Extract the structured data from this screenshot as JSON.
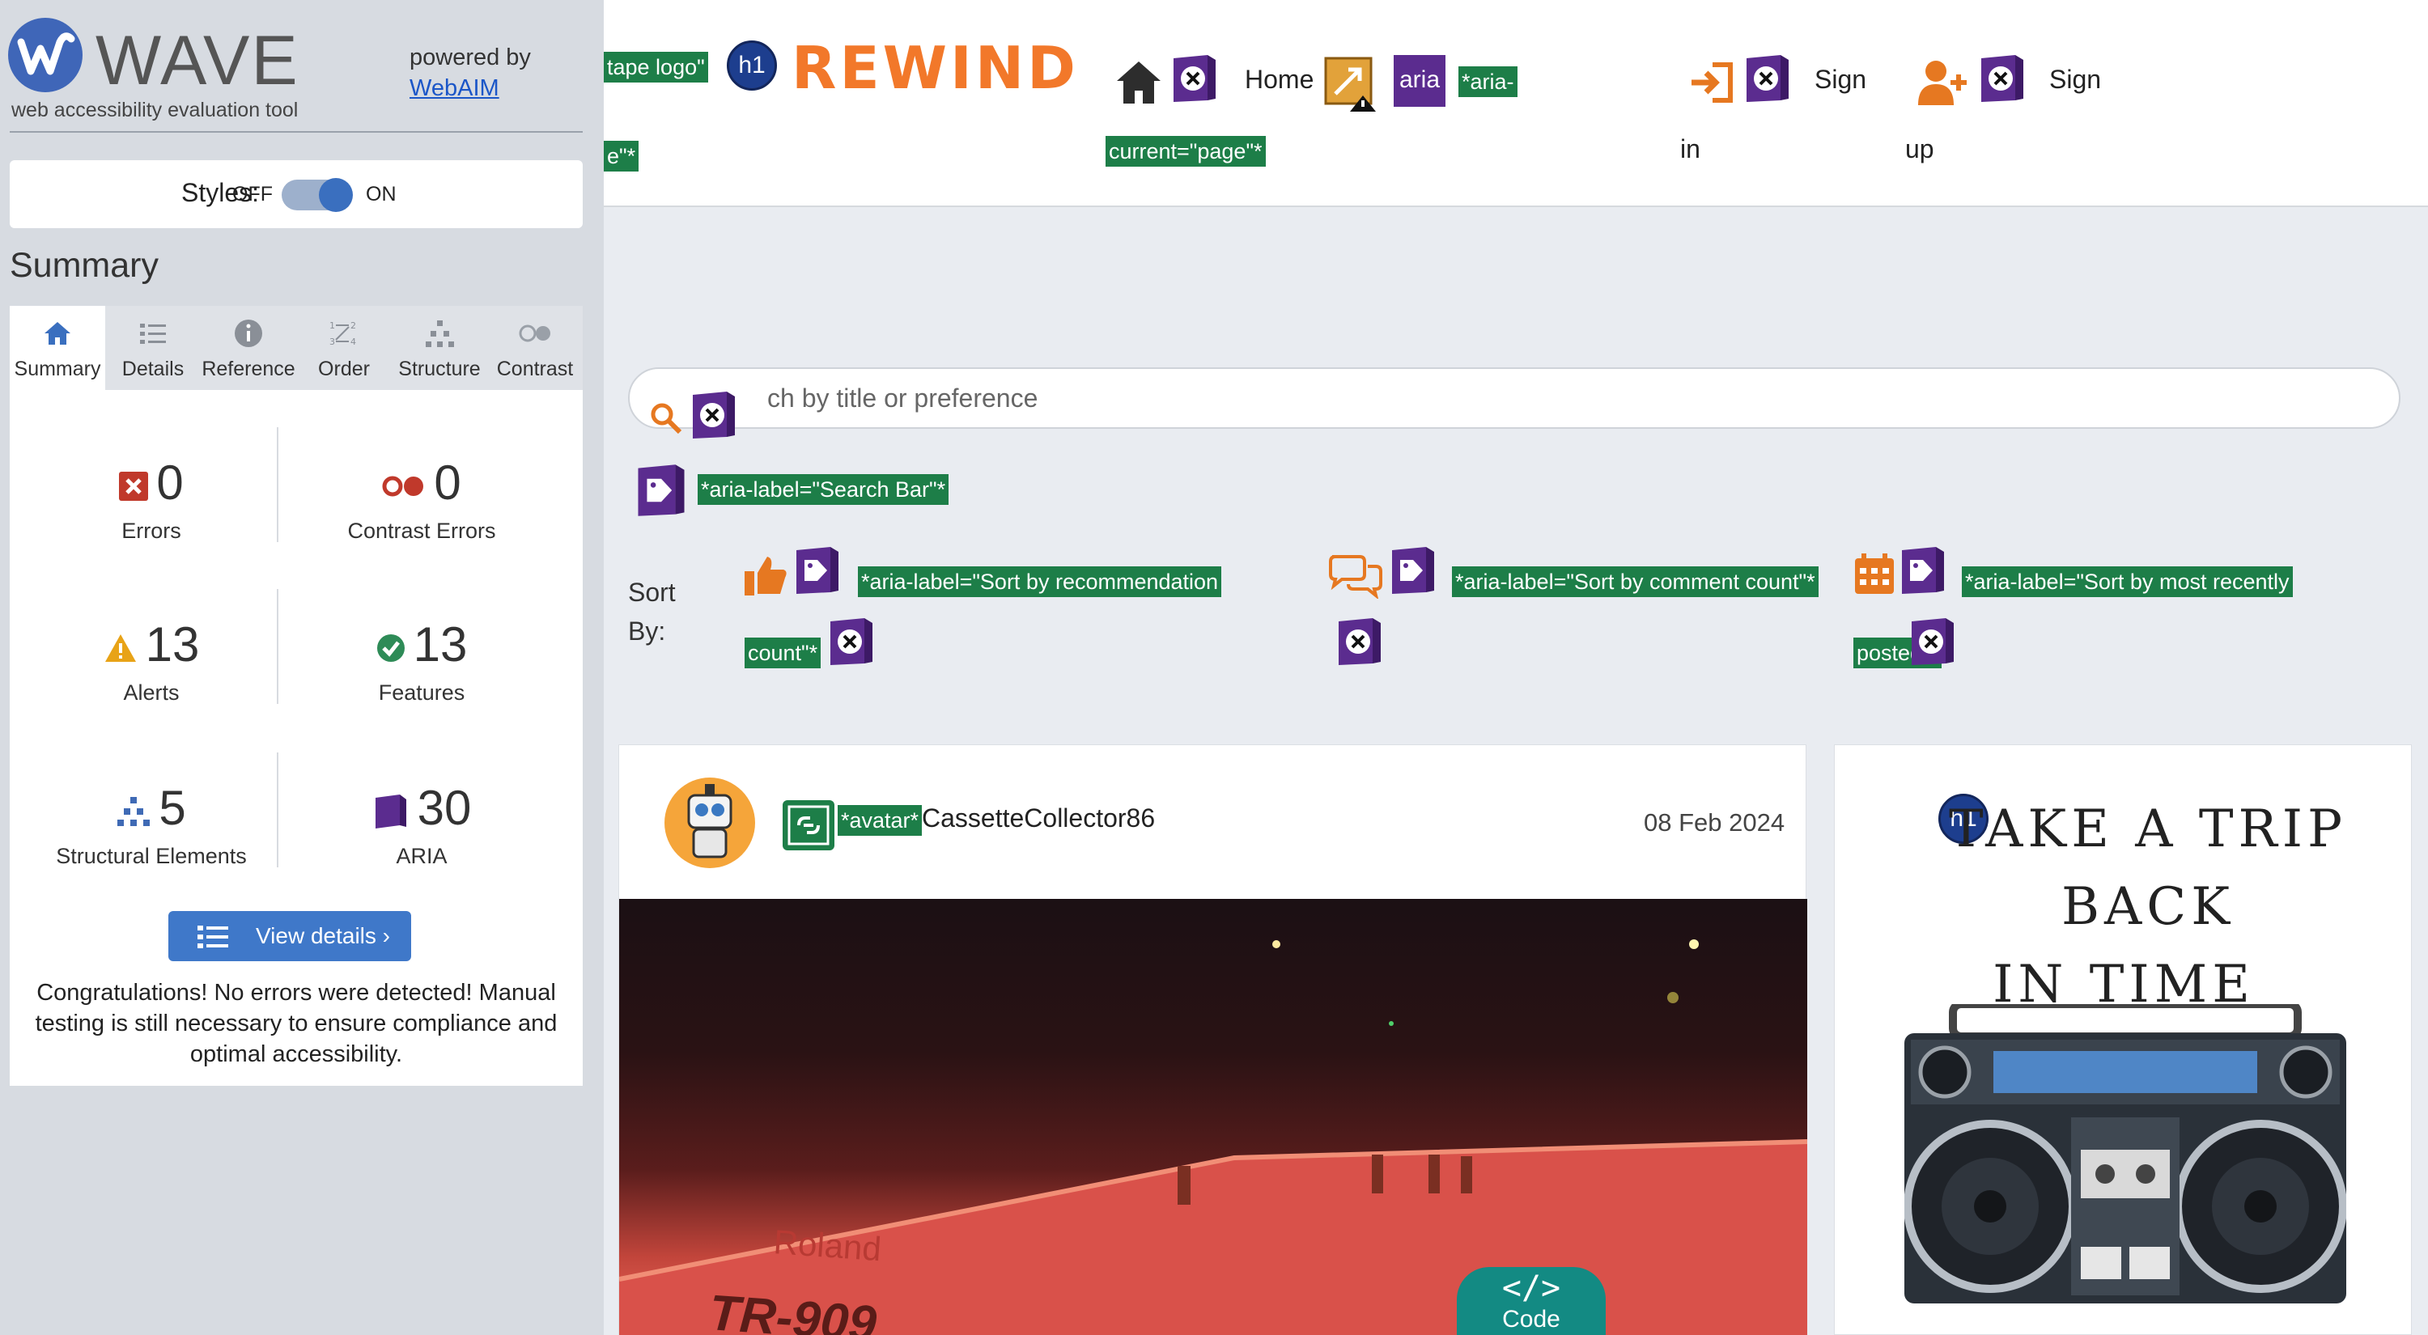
{
  "wave": {
    "brand": "WAVE",
    "tagline": "web accessibility evaluation tool",
    "powered_by": "powered by",
    "webaim_link": "WebAIM",
    "styles": {
      "label": "Styles:",
      "off": "OFF",
      "on": "ON",
      "state": "on"
    },
    "summary_title": "Summary",
    "tabs": [
      {
        "label": "Summary",
        "icon": "home-icon",
        "active": true
      },
      {
        "label": "Details",
        "icon": "list-icon",
        "active": false
      },
      {
        "label": "Reference",
        "icon": "info-icon",
        "active": false
      },
      {
        "label": "Order",
        "icon": "order-icon",
        "active": false
      },
      {
        "label": "Structure",
        "icon": "structure-icon",
        "active": false
      },
      {
        "label": "Contrast",
        "icon": "contrast-icon",
        "active": false
      }
    ],
    "stats": {
      "errors": {
        "value": "0",
        "label": "Errors"
      },
      "contrast_errors": {
        "value": "0",
        "label": "Contrast Errors"
      },
      "alerts": {
        "value": "13",
        "label": "Alerts"
      },
      "features": {
        "value": "13",
        "label": "Features"
      },
      "structural": {
        "value": "5",
        "label": "Structural Elements"
      },
      "aria": {
        "value": "30",
        "label": "ARIA"
      }
    },
    "view_details": "View details ›",
    "congrats": "Congratulations! No errors were detected! Manual testing is still necessary to ensure compliance and optimal accessibility.",
    "colors": {
      "sidebar_bg": "#d7dbe1",
      "accent": "#3f78c9",
      "error": "#c0392b",
      "alert": "#e8a317",
      "feature": "#2e8b57",
      "aria": "#5b2c8f"
    }
  },
  "page": {
    "header": {
      "logo_tag_line1": "tape logo\"",
      "logo_tag_line2": "e\"*",
      "h1": "h1",
      "brand": "REWIND",
      "home": "Home",
      "aria_badge": "aria",
      "aria_current_1": "*aria-",
      "aria_current_2": "current=\"page\"*",
      "sign_in_1": "Sign",
      "sign_in_2": "in",
      "sign_up_1": "Sign",
      "sign_up_2": "up"
    },
    "search": {
      "placeholder": "ch by title or preference",
      "aria_label": "*aria-label=\"Search Bar\"*"
    },
    "sort": {
      "label_1": "Sort",
      "label_2": "By:",
      "recommend_1": "*aria-label=\"Sort by recommendation",
      "recommend_2": "count\"*",
      "comments": "*aria-label=\"Sort by comment count\"*",
      "recent_1": "*aria-label=\"Sort by most recently",
      "recent_2": "posted\"*"
    },
    "post": {
      "avatar_tag": "*avatar*",
      "username": "CassetteCollector86",
      "date": "08 Feb 2024",
      "photo_brand": "Roland",
      "photo_model": "TR-909",
      "code_badge": "Code"
    },
    "side": {
      "h1": "h1",
      "title_1": "Take a trip back",
      "title_2": "in time"
    }
  }
}
